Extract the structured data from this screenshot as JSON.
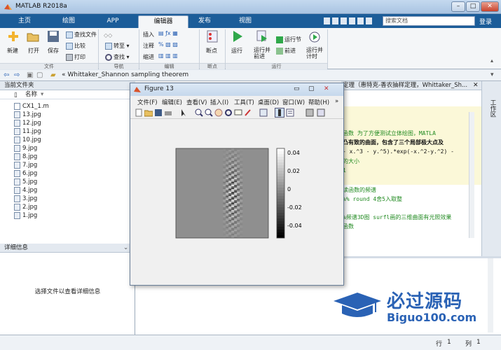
{
  "window": {
    "title": "MATLAB R2018a",
    "controls": [
      "–",
      "□",
      "✕"
    ]
  },
  "tabs": [
    {
      "label": "主页",
      "active": false
    },
    {
      "label": "绘图",
      "active": false
    },
    {
      "label": "APP",
      "active": false
    },
    {
      "label": "编辑器",
      "active": true
    },
    {
      "label": "发布",
      "active": false
    },
    {
      "label": "视图",
      "active": false
    }
  ],
  "search": {
    "placeholder": "搜索文档",
    "login": "登录"
  },
  "ribbon": {
    "file": {
      "new": "新建",
      "open": "打开",
      "save": "保存",
      "find_files": "查找文件",
      "compare": "比较",
      "print": "打印",
      "group": "文件"
    },
    "nav": {
      "goto": "转至",
      "find": "查找",
      "group": "导航"
    },
    "edit": {
      "insert": "插入",
      "comment": "注释",
      "indent": "缩进",
      "group": "编辑"
    },
    "breakpoints": {
      "label": "断点",
      "group": "断点"
    },
    "run": {
      "run": "运行",
      "run_advance": "运行并\n前进",
      "run_section": "运行节",
      "advance": "前进",
      "run_time": "运行并\n计时",
      "group": "运行"
    }
  },
  "address": {
    "path": "«  Whittaker_Shannon sampling theorem"
  },
  "current_folder": {
    "header": "当前文件夹",
    "column": "名称",
    "files": [
      "CX1_1.m",
      "13.jpg",
      "12.jpg",
      "11.jpg",
      "10.jpg",
      "9.jpg",
      "8.jpg",
      "7.jpg",
      "6.jpg",
      "5.jpg",
      "4.jpg",
      "3.jpg",
      "2.jpg",
      "1.jpg"
    ]
  },
  "details": {
    "header": "详细信息",
    "empty_text": "选择文件以查看详细信息"
  },
  "editor": {
    "tab_title": "定理（惠特克-香农抽样定理，Whittaker_Sh...",
    "lines": [
      "函数        为了方便测试立体绘图，MATLA",
      "凸有致的曲面，包含了三个局部极大点及",
      "- x.^3 - y.^5).*exp(-x.^2-y.^2) -",
      "的大小",
      "   1",
      "",
      "读函数的频谱",
      "   %% round  4舍5入取整",
      "",
      "   %频谱3D图  surfl画的三维曲面有光照效果",
      "函数"
    ]
  },
  "side_label": "工作区",
  "status": {
    "row_label": "行",
    "row": "1",
    "col_label": "列",
    "col": "1"
  },
  "figure": {
    "title": "Figure 13",
    "menu": [
      "文件(F)",
      "编辑(E)",
      "查看(V)",
      "插入(I)",
      "工具(T)",
      "桌面(D)",
      "窗口(W)",
      "帮助(H)"
    ],
    "colorbar_ticks": [
      "0.04",
      "0.02",
      "0",
      "-0.02",
      "-0.04"
    ]
  },
  "chart_data": {
    "type": "heatmap",
    "title": "",
    "colormap": "gray",
    "clim": [
      -0.05,
      0.05
    ],
    "colorbar_ticks": [
      0.04,
      0.02,
      0,
      -0.02,
      -0.04
    ]
  },
  "watermark": {
    "text": "必过源码",
    "url": "Biguo100.com"
  },
  "colors": {
    "tab_bar": "#1c5d99",
    "accent": "#2a62b5"
  }
}
